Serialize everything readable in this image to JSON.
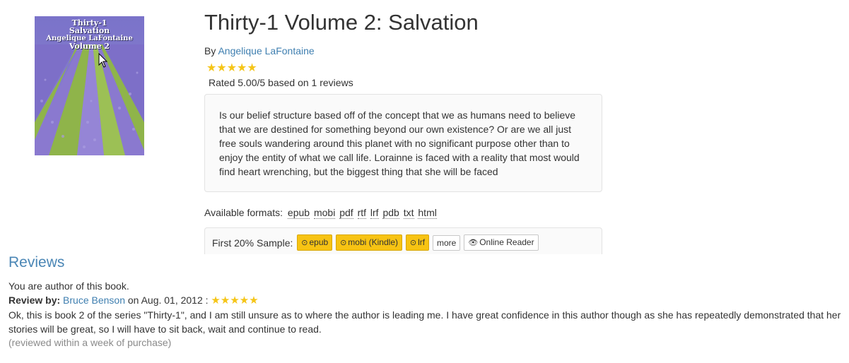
{
  "book": {
    "cover": {
      "title_line1": "Thirty-1",
      "title_line2": "Salvation",
      "author_line": "Angelique LaFontaine",
      "volume_line": "Volume 2"
    },
    "title": "Thirty-1 Volume 2: Salvation",
    "by_label": "By",
    "author": "Angelique LaFontaine",
    "stars": "★★★★★",
    "rating_text": "Rated 5.00/5 based on 1 reviews",
    "description": "Is our belief structure based off of the concept that we as humans need to believe that we are destined for something beyond our own existence? Or are we all just free souls wandering around this planet with no significant purpose other than to enjoy the entity of what we call life. Lorainne is faced with a reality that most would find heart wrenching, but the biggest thing that she will be faced"
  },
  "formats": {
    "label": "Available formats:",
    "items": [
      "epub",
      "mobi",
      "pdf",
      "rtf",
      "lrf",
      "pdb",
      "txt",
      "html"
    ]
  },
  "sample": {
    "label": "First 20% Sample:",
    "buttons": {
      "epub": "epub",
      "mobi": "mobi (Kindle)",
      "lrf": "lrf",
      "more": "more",
      "online_reader": "Online Reader"
    },
    "download_icon": "⊙",
    "eye_icon": "👁"
  },
  "reviews": {
    "heading": "Reviews",
    "author_note": "You are author of this book.",
    "items": [
      {
        "label": "Review by:",
        "reviewer": "Bruce Benson",
        "date_text": "on Aug. 01, 2012 :",
        "stars": "★★★★★",
        "text": "Ok, this is book 2 of the series \"Thirty-1\", and I am still unsure as to where the author is leading me. I have great confidence in this author though as she has repeatedly demonstrated that her stories will be great, so I will have to sit back, wait and continue to read.",
        "note": "(reviewed within a week of purchase)"
      }
    ]
  },
  "colors": {
    "link": "#3f7fb0",
    "star": "#f5c518",
    "button_warning": "#f7c313",
    "reviews_heading": "#4a86b5"
  }
}
